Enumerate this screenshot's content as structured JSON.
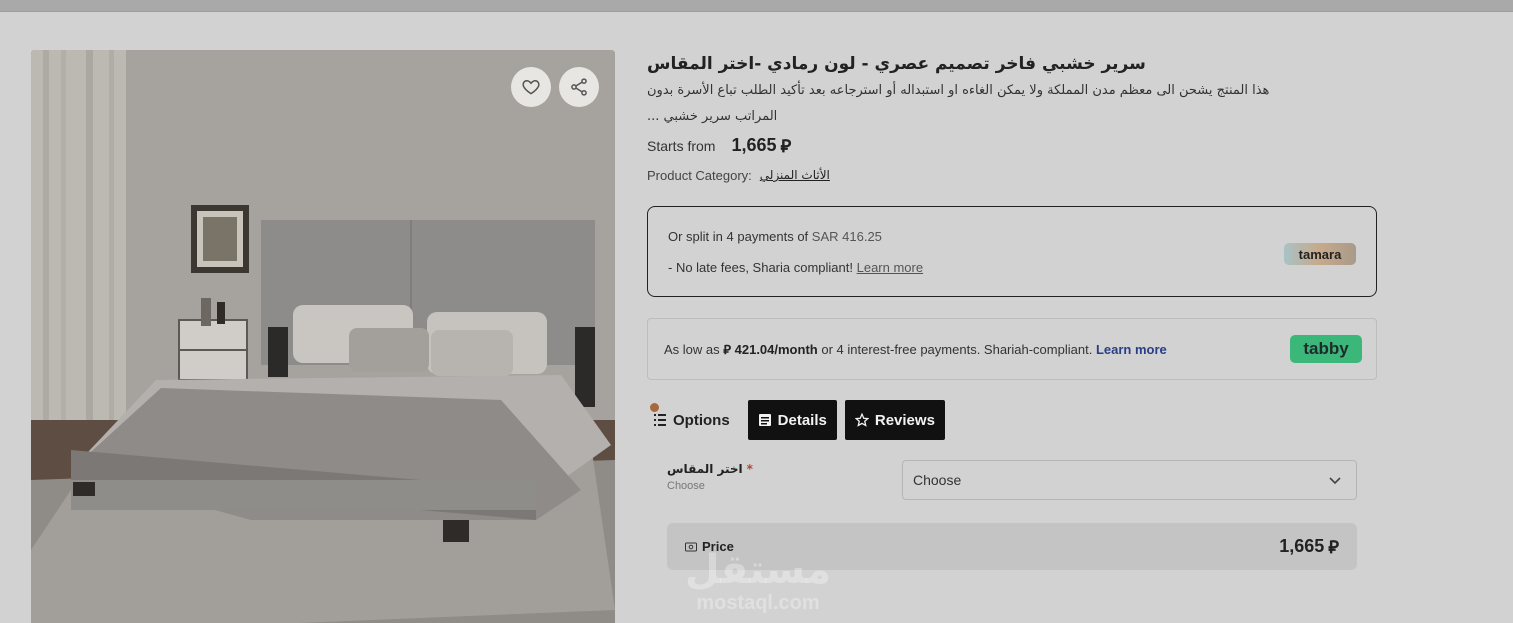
{
  "topbar": {
    "fragments": [
      "ﺀ",
      "ﺀ",
      "ﺀ",
      "ﺀ"
    ]
  },
  "product": {
    "title": "سرير خشبي فاخر تصميم عصري - لون رمادي -اختر المقاس",
    "description_line1": "هذا المنتج يشحن الى معظم مدن المملكة ولا يمكن الغاءه او استبداله أو استرجاعه بعد تأكيد الطلب تباع الأسرة بدون",
    "description_line2": "المراتب سرير خشبي ...",
    "starts_from_label": "Starts from",
    "price": "1,665",
    "currency_symbol": "⃁",
    "category_label": "Product Category:",
    "category_value": "الأثاث المنزلي",
    "image_alt_icon": "bed-photo"
  },
  "image_actions": {
    "wishlist_icon": "heart-icon",
    "share_icon": "share-icon"
  },
  "tamara": {
    "split_text": "Or split in 4 payments of",
    "amount": "SAR 416.25",
    "fees_text": "- No late fees, Sharia compliant!",
    "learn_more": "Learn more",
    "logo_text": "tamara"
  },
  "tabby": {
    "prefix": "As low as",
    "amount": "421.04/month",
    "suffix": "or 4 interest-free payments. Shariah-compliant.",
    "learn_more": "Learn more",
    "logo_text": "tabby",
    "brand_color": "#3bb77a"
  },
  "tabs": [
    {
      "label": "Options",
      "icon": "list-icon"
    },
    {
      "label": "Details",
      "icon": "book-icon"
    },
    {
      "label": "Reviews",
      "icon": "star-icon"
    }
  ],
  "size_option": {
    "label": "اختر المقاس",
    "required_mark": "*",
    "hint": "Choose",
    "select_value": "Choose"
  },
  "price_bar": {
    "label": "Price",
    "value": "1,665"
  },
  "watermark": {
    "arabic": "مستقل",
    "latin": "mostaql.com"
  }
}
